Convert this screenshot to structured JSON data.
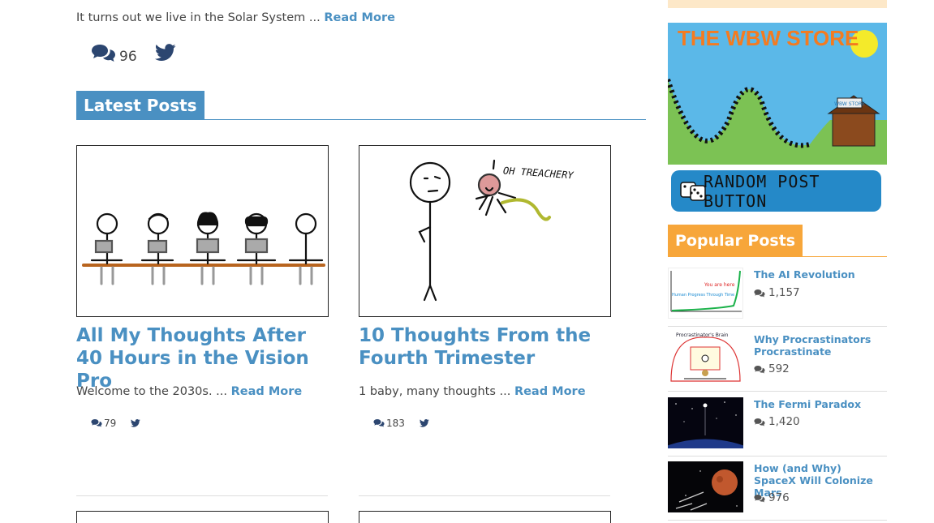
{
  "top_post": {
    "teaser": "It turns out we live in the Solar System ...",
    "read_more": "Read More",
    "comments": "96"
  },
  "latest": {
    "heading": "Latest Posts",
    "posts": [
      {
        "title": "All My Thoughts After 40 Hours in the Vision Pro",
        "teaser": "Welcome to the 2030s. ...",
        "read_more": "Read More",
        "comments": "79"
      },
      {
        "title": "10 Thoughts From the Fourth Trimester",
        "teaser": "1 baby, many thoughts ...",
        "read_more": "Read More",
        "comments": "183",
        "comic_caption": "OH TREACHERY"
      }
    ]
  },
  "sidebar": {
    "store_title": "THE WBW STORE",
    "store_sign": "WBW STORE",
    "random_button": "RANDOM POST BUTTON",
    "popular_heading": "Popular Posts",
    "popular": [
      {
        "title": "The AI Revolution",
        "comments": "1,157",
        "thumb_labels": [
          "You are here",
          "Human Progress Through Time"
        ]
      },
      {
        "title": "Why Procrastinators Procrastinate",
        "comments": "592",
        "thumb_labels": [
          "Procrastinator's Brain"
        ]
      },
      {
        "title": "The Fermi Paradox",
        "comments": "1,420"
      },
      {
        "title": "How (and Why) SpaceX Will Colonize Mars",
        "comments": "976"
      }
    ]
  },
  "colors": {
    "link_blue": "#4a90c2",
    "popular_orange": "#f7a63a",
    "twitter_navy": "#2c4670"
  },
  "icons": {
    "comment": "comment-bubbles-icon",
    "twitter": "twitter-bird-icon",
    "dice": "dice-icon"
  }
}
